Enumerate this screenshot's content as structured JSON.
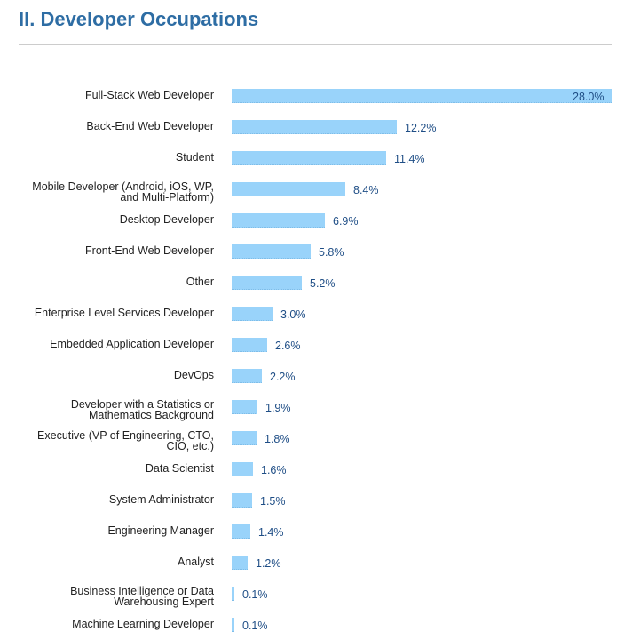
{
  "header": {
    "title": "II. Developer Occupations"
  },
  "colors": {
    "title": "#2e6da4",
    "bar": "#99d3fa",
    "value_label": "#1f4e86",
    "category_label": "#222222",
    "rule": "#cccccc"
  },
  "chart_data": {
    "type": "bar",
    "orientation": "horizontal",
    "title": "II. Developer Occupations",
    "xlabel": "",
    "ylabel": "",
    "unit": "%",
    "xlim": [
      0,
      28
    ],
    "grid": false,
    "legend": "none",
    "categories": [
      "Full-Stack Web Developer",
      "Back-End Web Developer",
      "Student",
      "Mobile Developer (Android, iOS, WP, and Multi-Platform)",
      "Desktop Developer",
      "Front-End Web Developer",
      "Other",
      "Enterprise Level Services Developer",
      "Embedded Application Developer",
      "DevOps",
      "Developer with a Statistics or Mathematics Background",
      "Executive (VP of Engineering, CTO, CIO, etc.)",
      "Data Scientist",
      "System Administrator",
      "Engineering Manager",
      "Analyst",
      "Business Intelligence or Data Warehousing Expert",
      "Machine Learning Developer"
    ],
    "label_lines": [
      [
        "Full-Stack Web Developer"
      ],
      [
        "Back-End Web Developer"
      ],
      [
        "Student"
      ],
      [
        "Mobile Developer (Android, iOS, WP,",
        "and Multi-Platform)"
      ],
      [
        "Desktop Developer"
      ],
      [
        "Front-End Web Developer"
      ],
      [
        "Other"
      ],
      [
        "Enterprise Level Services Developer"
      ],
      [
        "Embedded Application Developer"
      ],
      [
        "DevOps"
      ],
      [
        "Developer with a Statistics or",
        "Mathematics Background"
      ],
      [
        "Executive (VP of Engineering, CTO,",
        "CIO, etc.)"
      ],
      [
        "Data Scientist"
      ],
      [
        "System Administrator"
      ],
      [
        "Engineering Manager"
      ],
      [
        "Analyst"
      ],
      [
        "Business Intelligence or Data",
        "Warehousing Expert"
      ],
      [
        "Machine Learning Developer"
      ]
    ],
    "values": [
      28.0,
      12.2,
      11.4,
      8.4,
      6.9,
      5.8,
      5.2,
      3.0,
      2.6,
      2.2,
      1.9,
      1.8,
      1.6,
      1.5,
      1.4,
      1.2,
      0.1,
      0.1
    ],
    "value_labels": [
      "28.0%",
      "12.2%",
      "11.4%",
      "8.4%",
      "6.9%",
      "5.8%",
      "5.2%",
      "3.0%",
      "2.6%",
      "2.2%",
      "1.9%",
      "1.8%",
      "1.6%",
      "1.5%",
      "1.4%",
      "1.2%",
      "0.1%",
      "0.1%"
    ]
  }
}
